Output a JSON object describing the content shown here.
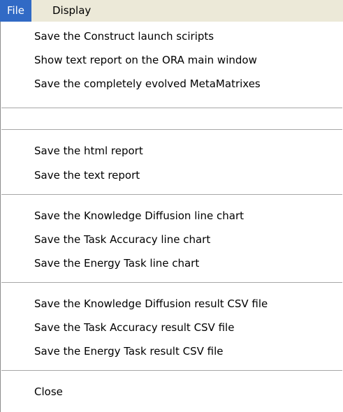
{
  "menubar": {
    "file": "File",
    "display": "Display"
  },
  "menu": {
    "items": [
      "Save the Construct launch sciripts",
      "Show text report on the ORA main window",
      "Save the completely evolved MetaMatrixes",
      "Save the html report",
      "Save the text report",
      "Save the Knowledge Diffusion line chart",
      "Save the Task Accuracy line chart",
      "Save the Energy Task line chart",
      "Save the Knowledge Diffusion result CSV file",
      "Save the Task Accuracy result CSV file",
      "Save the Energy Task result CSV file",
      "Close"
    ]
  },
  "colors": {
    "menubar_bg": "#ece9d8",
    "selected_bg": "#316ac5",
    "selected_text": "#ffffff",
    "separator": "#a7a7a7"
  }
}
